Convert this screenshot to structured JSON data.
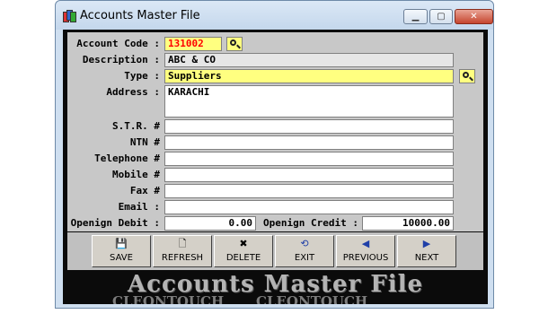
{
  "window": {
    "title": "Accounts Master File",
    "controls": {
      "minimize": "▁",
      "maximize": "▢",
      "close": "✕"
    }
  },
  "form": {
    "account_code": {
      "label": "Account Code :",
      "value": "131002"
    },
    "description": {
      "label": "Description :",
      "value": "ABC & CO"
    },
    "type": {
      "label": "Type :",
      "value": "Suppliers"
    },
    "address": {
      "label": "Address :",
      "value": "KARACHI"
    },
    "str": {
      "label": "S.T.R. #",
      "value": ""
    },
    "ntn": {
      "label": "NTN #",
      "value": ""
    },
    "telephone": {
      "label": "Telephone #",
      "value": ""
    },
    "mobile": {
      "label": "Mobile #",
      "value": ""
    },
    "fax": {
      "label": "Fax #",
      "value": ""
    },
    "email": {
      "label": "Email :",
      "value": ""
    },
    "opening_debit": {
      "label": "Openign Debit :",
      "value": "0.00"
    },
    "opening_credit": {
      "label": "Openign Credit :",
      "value": "10000.00"
    }
  },
  "toolbar": {
    "save": {
      "label": "SAVE",
      "icon": "save-icon"
    },
    "refresh": {
      "label": "REFRESH",
      "icon": "page-icon"
    },
    "delete": {
      "label": "DELETE",
      "icon": "delete-icon"
    },
    "exit": {
      "label": "EXIT",
      "icon": "exit-icon"
    },
    "previous": {
      "label": "PREVIOUS",
      "icon": "arrow-left-icon"
    },
    "next": {
      "label": "NEXT",
      "icon": "arrow-right-icon"
    }
  },
  "banner": {
    "title": "Accounts Master File",
    "watermark": "CLEONTOUCH"
  },
  "colors": {
    "input_highlight": "#ffff80",
    "account_code_text": "#ff0000",
    "form_background": "#c8c8c8",
    "banner_background": "#0b0b0b",
    "banner_text": "#b4b4b4"
  }
}
